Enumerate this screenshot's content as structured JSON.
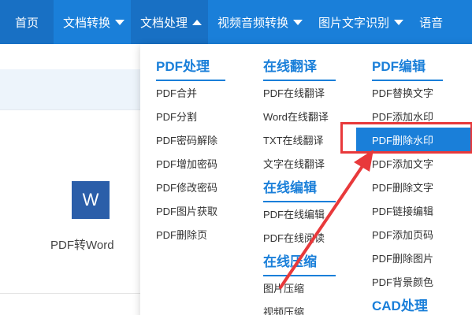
{
  "nav": {
    "items": [
      {
        "label": "首页"
      },
      {
        "label": "文档转换"
      },
      {
        "label": "文档处理"
      },
      {
        "label": "视频音频转换"
      },
      {
        "label": "图片文字识别"
      },
      {
        "label": "语音"
      }
    ]
  },
  "background": {
    "card_label": "PDF转Word",
    "icon_letter": "W"
  },
  "dropdown": {
    "col1": {
      "title": "PDF处理",
      "items": [
        "PDF合并",
        "PDF分割",
        "PDF密码解除",
        "PDF增加密码",
        "PDF修改密码",
        "PDF图片获取",
        "PDF删除页"
      ]
    },
    "col2": {
      "title": "在线翻译",
      "items": [
        "PDF在线翻译",
        "Word在线翻译",
        "TXT在线翻译",
        "文字在线翻译"
      ],
      "title2": "在线编辑",
      "items2": [
        "PDF在线编辑",
        "PDF在线阅读"
      ],
      "title3": "在线压缩",
      "items3": [
        "图片压缩",
        "视频压缩"
      ]
    },
    "col3": {
      "title": "PDF编辑",
      "items": [
        "PDF替换文字",
        "PDF添加水印",
        "PDF删除水印",
        "PDF添加文字",
        "PDF删除文字",
        "PDF链接编辑",
        "PDF添加页码",
        "PDF删除图片",
        "PDF背景颜色"
      ],
      "title2": "CAD处理",
      "highlighted_index": 2
    }
  },
  "colors": {
    "nav_bg": "#1a7fd9",
    "accent": "#1a7fd9",
    "annotation_red": "#e8393b"
  }
}
